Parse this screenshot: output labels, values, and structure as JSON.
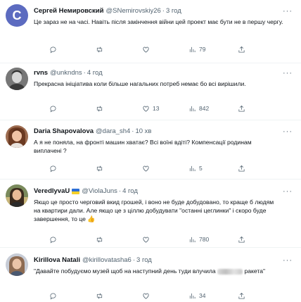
{
  "tweets": [
    {
      "name": "Сергей Немировский",
      "handle": "@SNemirovskiy26",
      "time": "3 год",
      "avatar_letter": "С",
      "text": "Це зараз не на часі. Навіть після закінчення війни цей проект має бути не в першу чергу.",
      "replies": "",
      "retweets": "",
      "likes": "",
      "views": "79"
    },
    {
      "name": "rvns",
      "handle": "@unkndns",
      "time": "4 год",
      "text": "Прекрасна ініціатива коли більше нагальних потреб немає бо всі вирішили.",
      "replies": "",
      "retweets": "",
      "likes": "13",
      "views": "842"
    },
    {
      "name": "Daria Shapovalova",
      "handle": "@dara_sh4",
      "time": "10 хв",
      "text": "А я не поняла, на фронті машин хватає? Всі воїні вдіті? Компенсації родинам виплачені ?",
      "replies": "",
      "retweets": "",
      "likes": "",
      "views": "5"
    },
    {
      "name": "VeredlyvaU",
      "handle": "@ViolaJuns",
      "time": "4 год",
      "text": "Якщо це просто черговий вкид грошей, і воно не буде добудовано, то краще б людям на квартири дали. Але якщо це з ціллю добудувати \"останні цеглинки\" і скоро буде завершення, то це",
      "replies": "",
      "retweets": "",
      "likes": "",
      "views": "780"
    },
    {
      "name": "Kirillova Natali",
      "handle": "@kirillovatasha6",
      "time": "3 год",
      "text_before": "\"Давайте побудуємо музей щоб на наступний день туди влучила",
      "text_after": "ракета\"",
      "replies": "",
      "retweets": "",
      "likes": "",
      "views": "34"
    }
  ],
  "icons": {
    "reply": "reply-icon",
    "retweet": "retweet-icon",
    "like": "heart-icon",
    "views": "views-icon",
    "share": "share-icon",
    "more": "more-icon"
  },
  "colors": {
    "text": "#0f1419",
    "secondary": "#536471",
    "divider": "#eff3f4",
    "link": "#1d9bf0"
  }
}
